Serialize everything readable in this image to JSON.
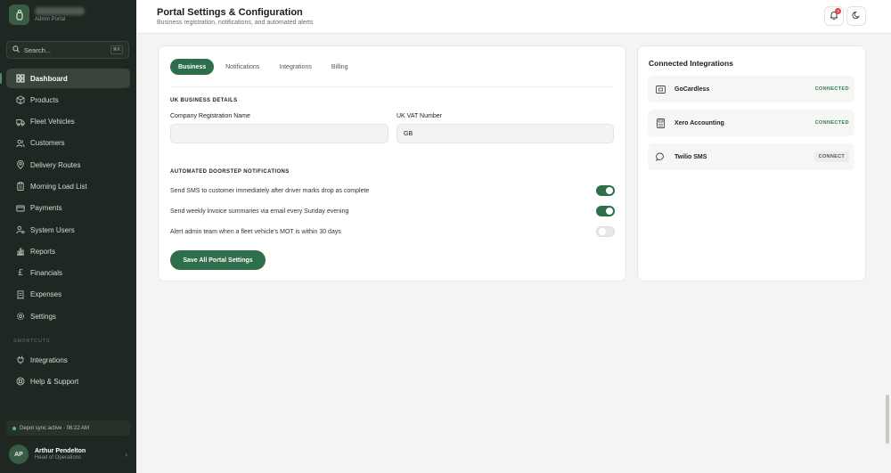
{
  "brand": {
    "subtitle": "Admin Portal"
  },
  "search": {
    "placeholder": "Search...",
    "shortcut": "⌘K"
  },
  "sidebar": {
    "items": [
      {
        "label": "Dashboard",
        "icon": "grid-icon",
        "active": true
      },
      {
        "label": "Products",
        "icon": "box-icon"
      },
      {
        "label": "Fleet Vehicles",
        "icon": "truck-icon"
      },
      {
        "label": "Customers",
        "icon": "users-icon"
      },
      {
        "label": "Delivery Routes",
        "icon": "map-pin-icon"
      },
      {
        "label": "Morning Load List",
        "icon": "clipboard-icon"
      },
      {
        "label": "Payments",
        "icon": "credit-card-icon"
      },
      {
        "label": "System Users",
        "icon": "user-cog-icon"
      },
      {
        "label": "Reports",
        "icon": "bar-chart-icon"
      },
      {
        "label": "Financials",
        "icon": "pound-icon"
      },
      {
        "label": "Expenses",
        "icon": "receipt-icon"
      },
      {
        "label": "Settings",
        "icon": "gear-icon"
      }
    ],
    "shortcuts_label": "SHORTCUTS",
    "shortcuts": [
      {
        "label": "Integrations",
        "icon": "plug-icon"
      },
      {
        "label": "Help & Support",
        "icon": "lifebuoy-icon"
      }
    ],
    "sync_status": "Depot sync active · 06:22 AM"
  },
  "user": {
    "initials": "AP",
    "name": "Arthur Pendelton",
    "role": "Head of Operations"
  },
  "header": {
    "title": "Portal Settings & Configuration",
    "subtitle": "Business registration, notifications, and automated alerts",
    "notification_count": "3"
  },
  "tabs": [
    "Business",
    "Notifications",
    "Integrations",
    "Billing"
  ],
  "business": {
    "section_title": "UK BUSINESS DETAILS",
    "company_reg_label": "Company Registration Name",
    "company_reg_value": "",
    "vat_label": "UK VAT Number",
    "vat_value": "GB"
  },
  "notifications": {
    "section_title": "AUTOMATED DOORSTEP NOTIFICATIONS",
    "toggles": [
      {
        "label": "Send SMS to customer immediately after driver marks drop as complete",
        "on": true
      },
      {
        "label": "Send weekly invoice summaries via email every Sunday evening",
        "on": true
      },
      {
        "label": "Alert admin team when a fleet vehicle's MOT is within 30 days",
        "on": false
      }
    ]
  },
  "save_label": "Save All Portal Settings",
  "integrations": {
    "title": "Connected Integrations",
    "items": [
      {
        "name": "GoCardless",
        "status": "CONNECTED",
        "icon": "card-icon"
      },
      {
        "name": "Xero Accounting",
        "status": "CONNECTED",
        "icon": "calculator-icon"
      },
      {
        "name": "Twilio SMS",
        "status": "CONNECT",
        "icon": "message-icon"
      }
    ]
  },
  "colors": {
    "accent": "#2f6e4a",
    "sidebar_bg": "#1e2721",
    "connected": "#2f7d4f",
    "badge": "#d94343"
  }
}
